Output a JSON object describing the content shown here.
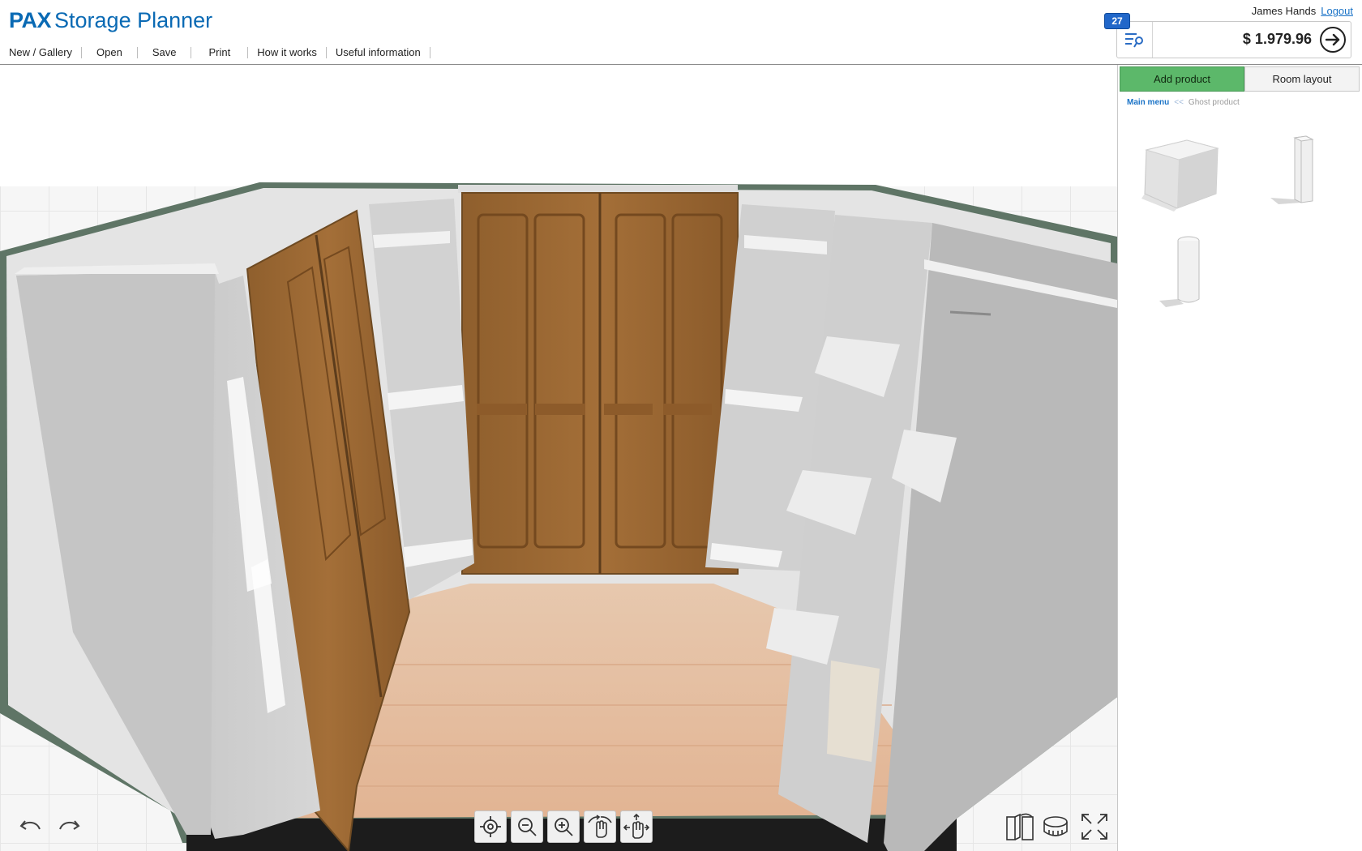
{
  "app": {
    "brand": "PAX",
    "title": "Storage Planner"
  },
  "menu": {
    "items": [
      {
        "label": "New / Gallery"
      },
      {
        "label": "Open"
      },
      {
        "label": "Save"
      },
      {
        "label": "Print"
      },
      {
        "label": "How it works"
      },
      {
        "label": "Useful information"
      }
    ]
  },
  "user": {
    "name": "James Hands",
    "logout_label": "Logout"
  },
  "cart": {
    "count": "27",
    "price": "$ 1.979.96"
  },
  "panel": {
    "tabs": [
      {
        "label": "Add product",
        "active": true
      },
      {
        "label": "Room layout",
        "active": false
      }
    ],
    "breadcrumb": {
      "root": "Main menu",
      "separator": "<<",
      "current": "Ghost product"
    },
    "products": [
      {
        "icon": "ghost-cube-icon"
      },
      {
        "icon": "ghost-tall-box-icon"
      },
      {
        "icon": "ghost-cylinder-icon"
      }
    ]
  },
  "toolbar": {
    "view_tools": [
      "center-view-icon",
      "zoom-out-icon",
      "zoom-in-icon",
      "rotate-view-icon",
      "pan-view-icon"
    ],
    "history": [
      "undo-icon",
      "redo-icon"
    ],
    "right_tools": [
      "toggle-doors-icon",
      "measure-tape-icon",
      "fullscreen-icon"
    ]
  },
  "colors": {
    "brand": "#0a6ab4",
    "active_tab": "#5cb86a",
    "badge": "#2167c9",
    "link": "#1a73c7"
  }
}
